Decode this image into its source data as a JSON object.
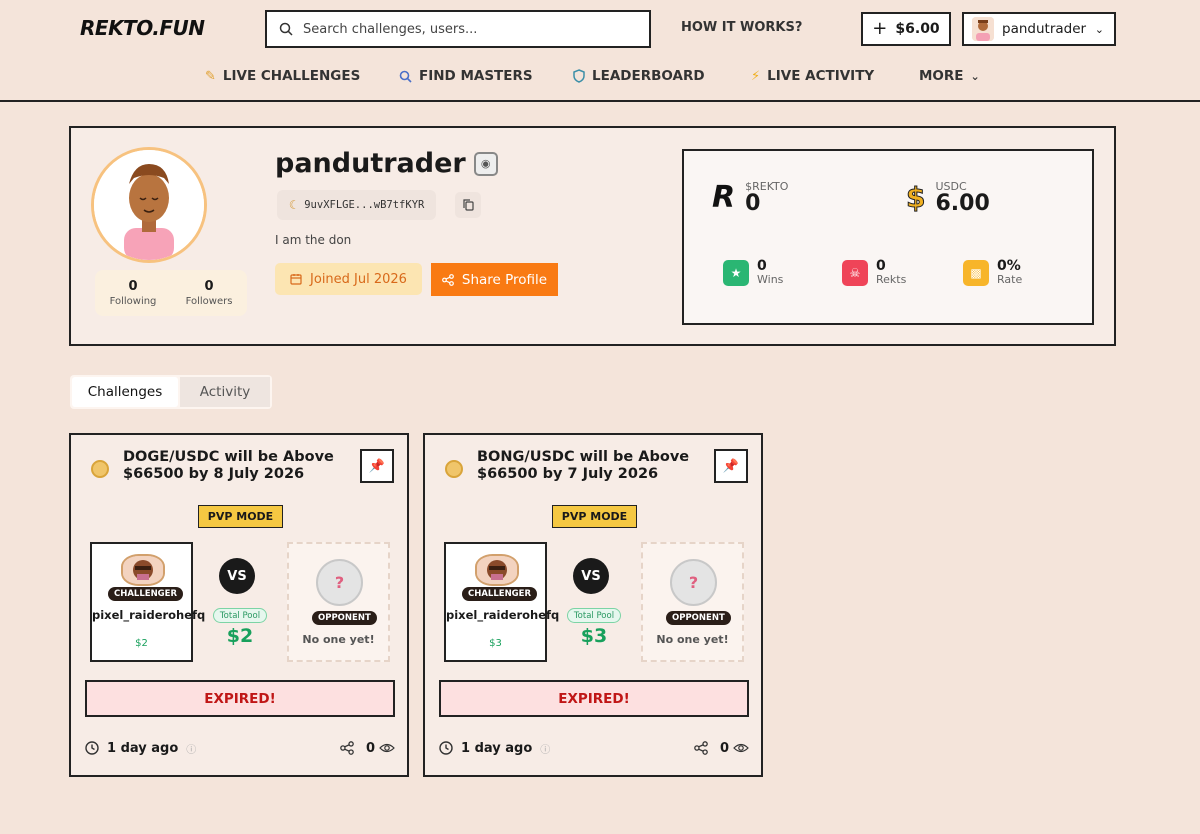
{
  "header": {
    "logo": "REKTO.FUN",
    "search_placeholder": "Search challenges, users...",
    "how_it_works": "HOW IT WORKS?",
    "balance": "$6.00",
    "username": "pandutrader"
  },
  "nav": [
    {
      "label": "LIVE CHALLENGES",
      "icon": "pencil-icon"
    },
    {
      "label": "FIND MASTERS",
      "icon": "search-icon"
    },
    {
      "label": "LEADERBOARD",
      "icon": "shield-icon"
    },
    {
      "label": "LIVE ACTIVITY",
      "icon": "lightning-icon"
    },
    {
      "label": "MORE",
      "icon": "chevron-down-icon"
    }
  ],
  "profile": {
    "username": "pandutrader",
    "wallet": "9uvXFLGE...wB7tfKYR",
    "bio": "I am the don",
    "joined": "Joined Jul 2026",
    "share": "Share Profile",
    "following_count": "0",
    "following_label": "Following",
    "followers_count": "0",
    "followers_label": "Followers",
    "stats": {
      "rekto_label": "$REKTO",
      "rekto_value": "0",
      "usdc_label": "USDC",
      "usdc_value": "6.00",
      "wins_value": "0",
      "wins_label": "Wins",
      "rekts_value": "0",
      "rekts_label": "Rekts",
      "rate_value": "0%",
      "rate_label": "Rate"
    }
  },
  "tabs": [
    {
      "label": "Challenges",
      "active": true
    },
    {
      "label": "Activity",
      "active": false
    }
  ],
  "cards": [
    {
      "title": "DOGE/USDC will be Above $66500 by 8 July 2026",
      "mode": "PVP MODE",
      "challenger_label": "CHALLENGER",
      "challenger_name": "pixel_raiderohefq",
      "challenger_amount": "$2",
      "vs": "VS",
      "pool_label": "Total Pool",
      "pool_value": "$2",
      "opponent_label": "OPPONENT",
      "opponent_text": "No one yet!",
      "status": "EXPIRED!",
      "time": "1 day ago",
      "views": "0"
    },
    {
      "title": "BONG/USDC will be Above $66500 by 7 July 2026",
      "mode": "PVP MODE",
      "challenger_label": "CHALLENGER",
      "challenger_name": "pixel_raiderohefq",
      "challenger_amount": "$3",
      "vs": "VS",
      "pool_label": "Total Pool",
      "pool_value": "$3",
      "opponent_label": "OPPONENT",
      "opponent_text": "No one yet!",
      "status": "EXPIRED!",
      "time": "1 day ago",
      "views": "0"
    }
  ],
  "colors": {
    "background": "#f4e4da",
    "accent_orange": "#f97a13",
    "success_green": "#18a05c",
    "expired_red": "#c01616",
    "pvp_yellow": "#f5c842"
  }
}
